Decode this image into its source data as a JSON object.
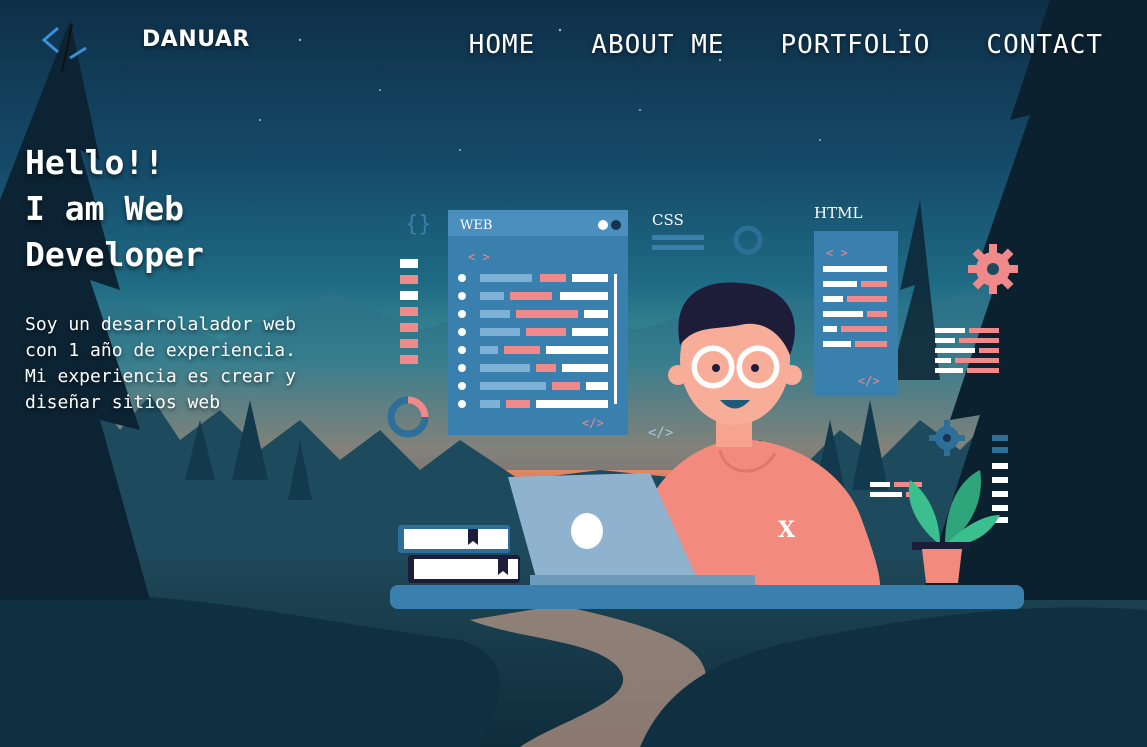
{
  "brand": {
    "name": "DANUAR"
  },
  "nav": {
    "items": [
      "HOME",
      "ABOUT ME",
      "PORTFOLIO",
      "CONTACT"
    ]
  },
  "hero": {
    "title_lines": [
      "Hello!!",
      "I am Web",
      "Developer"
    ],
    "description_lines": [
      "Soy un desarrolalador web",
      "con 1 año de experiencia.",
      "Mi experiencia es crear y",
      "diseñar sitios web"
    ]
  },
  "illustration": {
    "window_label": "WEB",
    "css_label": "CSS",
    "html_label": "HTML",
    "code_open_tag": "< >",
    "code_close_tag": "</>",
    "shirt_letter": "X"
  },
  "colors": {
    "accent": "#f08a8a",
    "panel": "#3a80ae",
    "panel_header": "#4b8fbe",
    "sky_top": "#0f2f48",
    "sunset": "#e79a6a"
  }
}
